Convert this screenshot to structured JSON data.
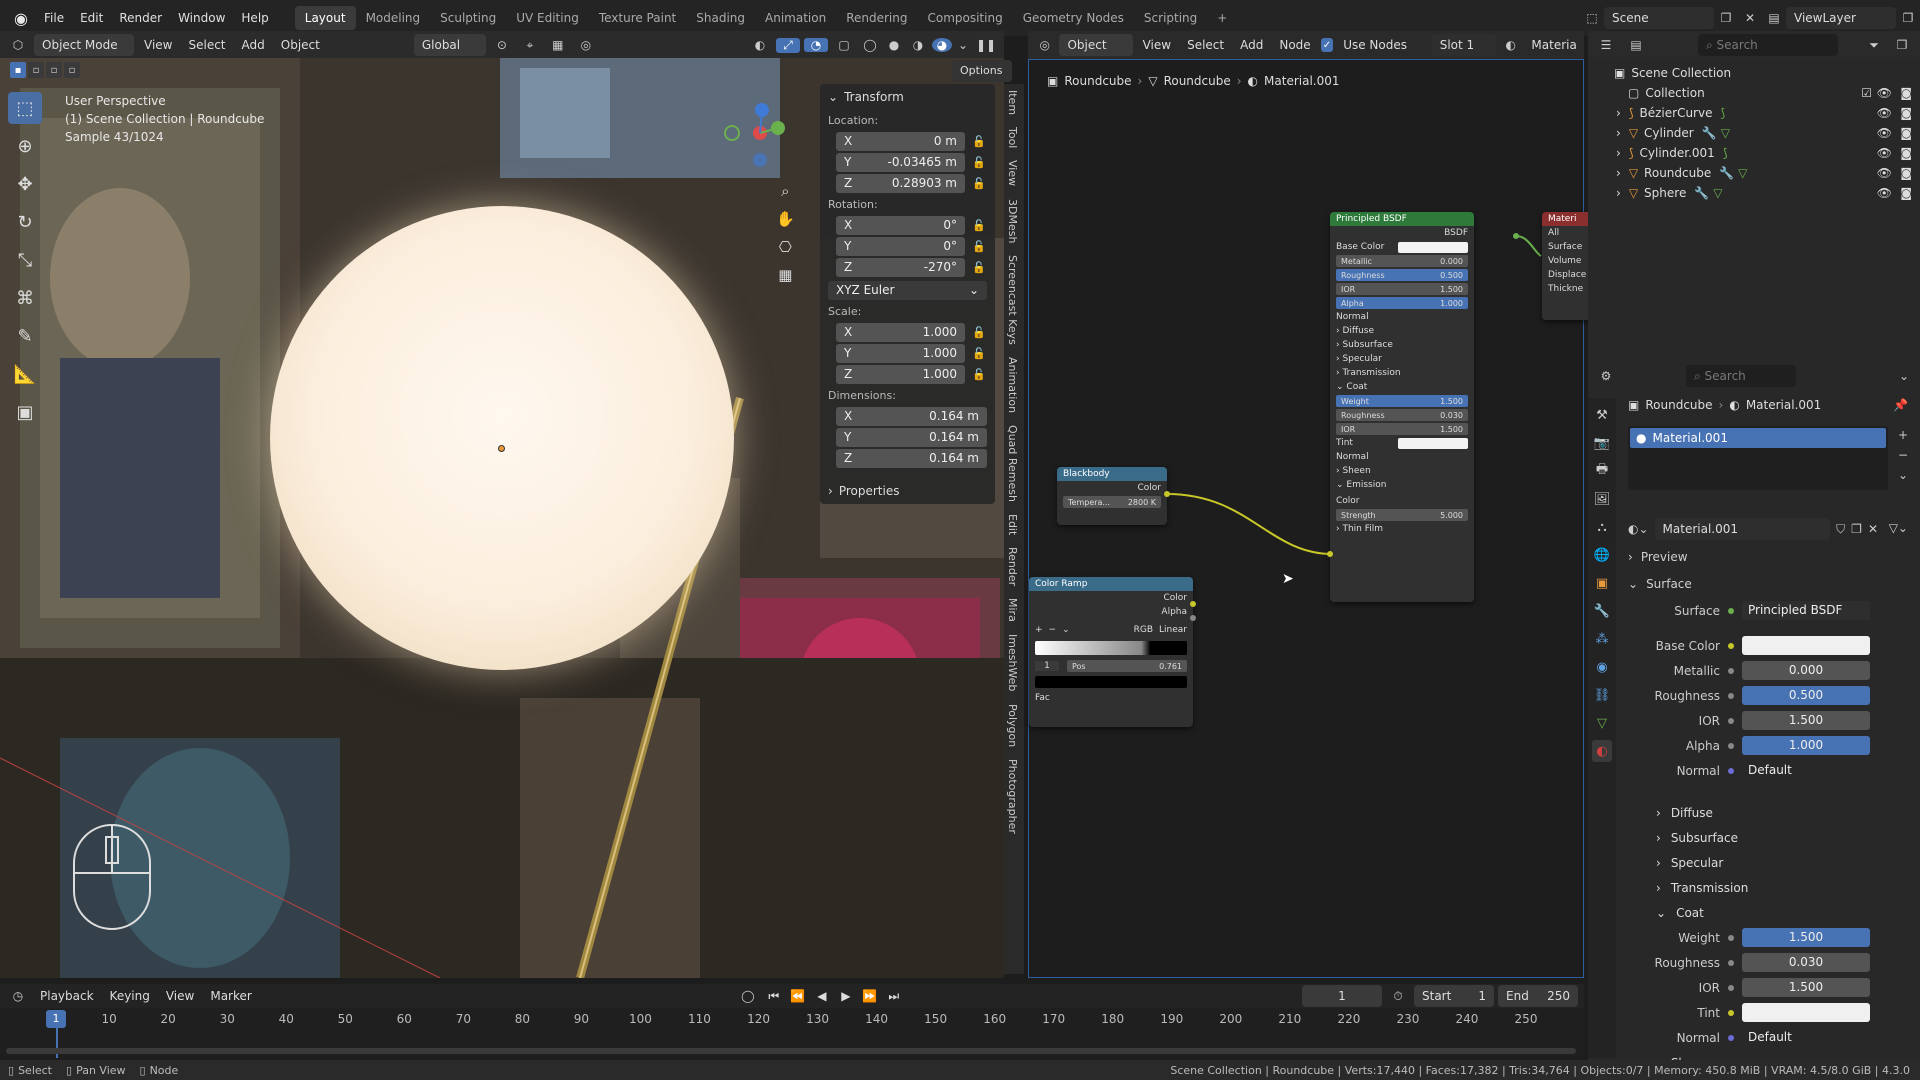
{
  "menubar": {
    "items": [
      "File",
      "Edit",
      "Render",
      "Window",
      "Help"
    ],
    "workspaces": [
      "Layout",
      "Modeling",
      "Sculpting",
      "UV Editing",
      "Texture Paint",
      "Shading",
      "Animation",
      "Rendering",
      "Compositing",
      "Geometry Nodes",
      "Scripting"
    ],
    "active_workspace": "Layout",
    "add_tab": "+",
    "scene_label": "Scene",
    "viewlayer_label": "ViewLayer"
  },
  "viewport": {
    "mode": "Object Mode",
    "menus": [
      "View",
      "Select",
      "Add",
      "Object"
    ],
    "orientation": "Global",
    "options": "Options",
    "info_line1": "User Perspective",
    "info_line2": "(1) Scene Collection | Roundcube",
    "info_line3": "Sample 43/1024"
  },
  "npanel": {
    "transform_title": "Transform",
    "location_label": "Location:",
    "location": [
      {
        "axis": "X",
        "value": "0 m"
      },
      {
        "axis": "Y",
        "value": "-0.03465 m"
      },
      {
        "axis": "Z",
        "value": "0.28903 m"
      }
    ],
    "rotation_label": "Rotation:",
    "rotation": [
      {
        "axis": "X",
        "value": "0°"
      },
      {
        "axis": "Y",
        "value": "0°"
      },
      {
        "axis": "Z",
        "value": "-270°"
      }
    ],
    "rotation_mode": "XYZ Euler",
    "scale_label": "Scale:",
    "scale": [
      {
        "axis": "X",
        "value": "1.000"
      },
      {
        "axis": "Y",
        "value": "1.000"
      },
      {
        "axis": "Z",
        "value": "1.000"
      }
    ],
    "dimensions_label": "Dimensions:",
    "dimensions": [
      {
        "axis": "X",
        "value": "0.164 m"
      },
      {
        "axis": "Y",
        "value": "0.164 m"
      },
      {
        "axis": "Z",
        "value": "0.164 m"
      }
    ],
    "properties_title": "Properties",
    "side_tabs": [
      "Item",
      "Tool",
      "View",
      "3DMesh",
      "Screencast Keys",
      "Animation",
      "Quad Remesh",
      "Edit",
      "Render",
      "Mira",
      "ImeshWeb",
      "Polygon",
      "Photographer"
    ]
  },
  "node_editor": {
    "type": "Object",
    "menus": [
      "View",
      "Select",
      "Add",
      "Node"
    ],
    "use_nodes": "Use Nodes",
    "slot": "Slot 1",
    "material_short": "Materia",
    "breadcrumb": [
      "Roundcube",
      "Roundcube",
      "Material.001"
    ],
    "principled": {
      "title": "Principled BSDF",
      "out": "BSDF",
      "rows": [
        {
          "label": "Metallic",
          "value": "0.000",
          "blue": false
        },
        {
          "label": "Roughness",
          "value": "0.500",
          "blue": true
        },
        {
          "label": "IOR",
          "value": "1.500",
          "blue": false
        },
        {
          "label": "Alpha",
          "value": "1.000",
          "blue": true
        }
      ],
      "base_color": "Base Color",
      "normal": "Normal",
      "subs": [
        "Diffuse",
        "Subsurface",
        "Specular",
        "Transmission"
      ],
      "coat": "Coat",
      "coat_rows": [
        {
          "label": "Weight",
          "value": "1.500",
          "blue": true
        },
        {
          "label": "Roughness",
          "value": "0.030",
          "blue": false
        },
        {
          "label": "IOR",
          "value": "1.500",
          "blue": false
        }
      ],
      "tint": "Tint",
      "coat_normal": "Normal",
      "sheen": "Sheen",
      "emission": "Emission",
      "em_color": "Color",
      "strength_label": "Strength",
      "strength": "5.000",
      "thin_film": "Thin Film"
    },
    "output": {
      "title": "Materi",
      "target": "All",
      "sockets": [
        "Surface",
        "Volume",
        "Displace",
        "Thickne"
      ]
    },
    "blackbody": {
      "title": "Blackbody",
      "out": "Color",
      "temp_label": "Tempera...",
      "temp": "2800 K"
    },
    "colorramp": {
      "title": "Color Ramp",
      "outs": [
        "Color",
        "Alpha"
      ],
      "mode": "RGB",
      "interp": "Linear",
      "index": "1",
      "pos_label": "Pos",
      "pos": "0.761",
      "fac": "Fac"
    }
  },
  "outliner": {
    "search_placeholder": "Search",
    "root": "Scene Collection",
    "collection": "Collection",
    "items": [
      "BézierCurve",
      "Cylinder",
      "Cylinder.001",
      "Roundcube",
      "Sphere"
    ]
  },
  "properties": {
    "search_placeholder": "Search",
    "breadcrumb": [
      "Roundcube",
      "Material.001"
    ],
    "slot_name": "Material.001",
    "material_name": "Material.001",
    "preview": "Preview",
    "surface_section": "Surface",
    "surface_label": "Surface",
    "surface_value": "Principled BSDF",
    "rows": [
      {
        "label": "Base Color",
        "value": "",
        "style": "white"
      },
      {
        "label": "Metallic",
        "value": "0.000",
        "style": "grey"
      },
      {
        "label": "Roughness",
        "value": "0.500",
        "style": "blue"
      },
      {
        "label": "IOR",
        "value": "1.500",
        "style": "grey"
      },
      {
        "label": "Alpha",
        "value": "1.000",
        "style": "blue"
      },
      {
        "label": "Normal",
        "value": "Default",
        "style": "plain"
      }
    ],
    "subs": [
      "Diffuse",
      "Subsurface",
      "Specular",
      "Transmission"
    ],
    "coat": "Coat",
    "coat_rows": [
      {
        "label": "Weight",
        "value": "1.500",
        "style": "blue"
      },
      {
        "label": "Roughness",
        "value": "0.030",
        "style": "grey"
      },
      {
        "label": "IOR",
        "value": "1.500",
        "style": "grey"
      },
      {
        "label": "Tint",
        "value": "",
        "style": "white"
      },
      {
        "label": "Normal",
        "value": "Default",
        "style": "plain"
      }
    ],
    "sheen": "Sheen"
  },
  "timeline": {
    "menus": [
      "Playback",
      "Keying",
      "View",
      "Marker"
    ],
    "current_frame": "1",
    "start_label": "Start",
    "start": "1",
    "end_label": "End",
    "end": "250",
    "ticks": [
      "1",
      "10",
      "20",
      "30",
      "40",
      "50",
      "60",
      "70",
      "80",
      "90",
      "100",
      "110",
      "120",
      "130",
      "140",
      "150",
      "160",
      "170",
      "180",
      "190",
      "200",
      "210",
      "220",
      "230",
      "240",
      "250"
    ]
  },
  "statusbar": {
    "select": "Select",
    "pan": "Pan View",
    "node": "Node",
    "stats": "Scene Collection | Roundcube | Verts:17,440 | Faces:17,382 | Tris:34,764 | Objects:0/7 | Memory: 450.8 MiB | VRAM: 4.5/8.0 GiB | 4.3.0"
  },
  "colors": {
    "accent": "#4772b3",
    "node_shader": "#2d7a3b",
    "node_converter": "#3a6c8a",
    "emission_link": "#c7c729"
  }
}
